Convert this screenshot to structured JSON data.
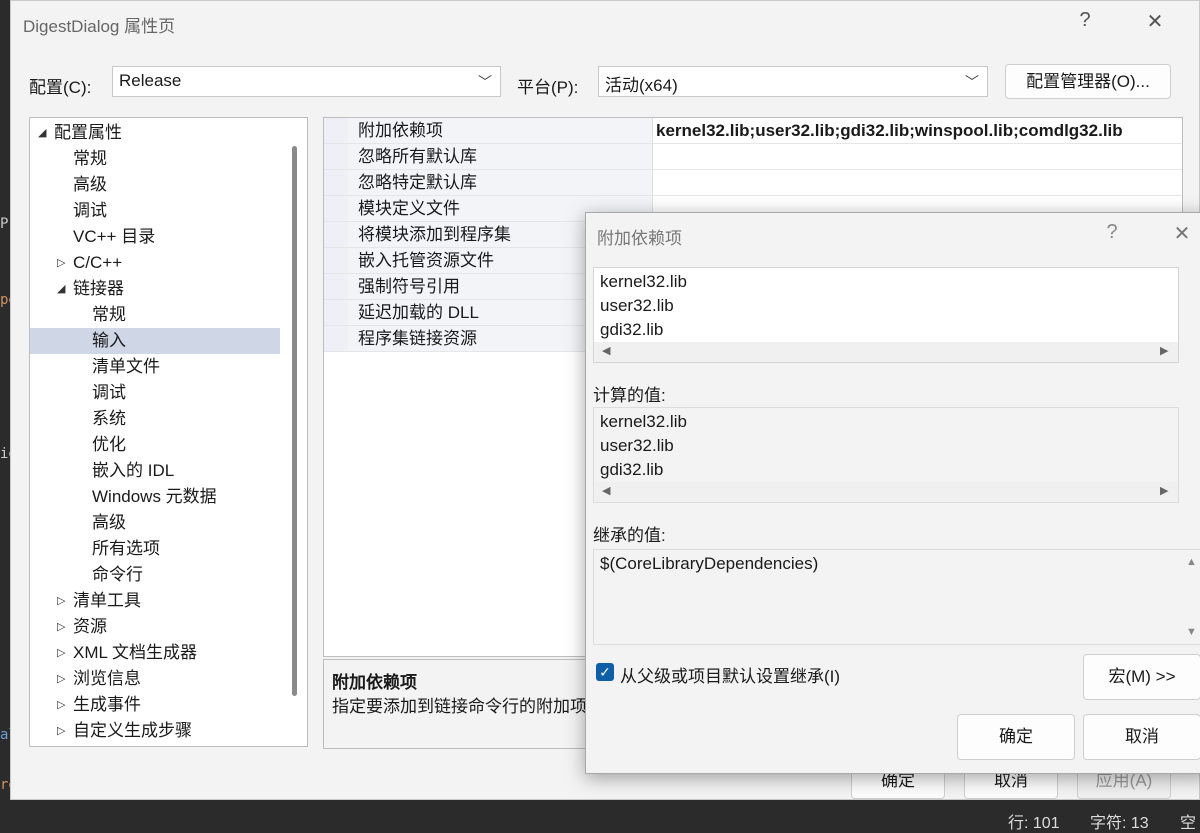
{
  "window": {
    "title": "DigestDialog 属性页",
    "help_glyph": "?",
    "close_glyph": "✕"
  },
  "config_bar": {
    "config_label": "配置(C):",
    "config_value": "Release",
    "platform_label": "平台(P):",
    "platform_value": "活动(x64)",
    "manager_button": "配置管理器(O)..."
  },
  "tree": {
    "items": [
      {
        "label": "配置属性",
        "arrow": "◢"
      },
      {
        "label": "常规"
      },
      {
        "label": "高级"
      },
      {
        "label": "调试"
      },
      {
        "label": "VC++ 目录"
      },
      {
        "label": "C/C++",
        "arrow": "▷"
      },
      {
        "label": "链接器",
        "arrow": "◢"
      },
      {
        "label": "常规"
      },
      {
        "label": "输入",
        "selected": true
      },
      {
        "label": "清单文件"
      },
      {
        "label": "调试"
      },
      {
        "label": "系统"
      },
      {
        "label": "优化"
      },
      {
        "label": "嵌入的 IDL"
      },
      {
        "label": "Windows 元数据"
      },
      {
        "label": "高级"
      },
      {
        "label": "所有选项"
      },
      {
        "label": "命令行"
      },
      {
        "label": "清单工具",
        "arrow": "▷"
      },
      {
        "label": "资源",
        "arrow": "▷"
      },
      {
        "label": "XML 文档生成器",
        "arrow": "▷"
      },
      {
        "label": "浏览信息",
        "arrow": "▷"
      },
      {
        "label": "生成事件",
        "arrow": "▷"
      },
      {
        "label": "自定义生成步骤",
        "arrow": "▷"
      }
    ]
  },
  "grid": {
    "rows": [
      {
        "name": "附加依赖项",
        "value": "kernel32.lib;user32.lib;gdi32.lib;winspool.lib;comdlg32.lib"
      },
      {
        "name": "忽略所有默认库",
        "value": ""
      },
      {
        "name": "忽略特定默认库",
        "value": ""
      },
      {
        "name": "模块定义文件",
        "value": ""
      },
      {
        "name": "将模块添加到程序集",
        "value": ""
      },
      {
        "name": "嵌入托管资源文件",
        "value": ""
      },
      {
        "name": "强制符号引用",
        "value": ""
      },
      {
        "name": "延迟加载的 DLL",
        "value": ""
      },
      {
        "name": "程序集链接资源",
        "value": ""
      }
    ]
  },
  "description": {
    "title": "附加依赖项",
    "text": "指定要添加到链接命令行的附加项"
  },
  "footer": {
    "ok": "确定",
    "cancel": "取消",
    "apply": "应用(A)"
  },
  "sub_dialog": {
    "title": "附加依赖项",
    "help_glyph": "?",
    "close_glyph": "✕",
    "edit_lines": [
      "kernel32.lib",
      "user32.lib",
      "gdi32.lib"
    ],
    "computed_label": "计算的值:",
    "computed_lines": [
      "kernel32.lib",
      "user32.lib",
      "gdi32.lib"
    ],
    "inherited_label": "继承的值:",
    "inherited_lines": [
      "$(CoreLibraryDependencies)"
    ],
    "inherit_checkbox": "从父级或项目默认设置继承(I)",
    "inherit_checked": true,
    "macro_button": "宏(M) >>",
    "ok": "确定",
    "cancel": "取消"
  },
  "status_bar": {
    "line": "行: 101",
    "char": "字符: 13",
    "extra": "空"
  },
  "colors": {
    "selection": "#cfd6e6",
    "checkbox": "#0f5ea8"
  }
}
